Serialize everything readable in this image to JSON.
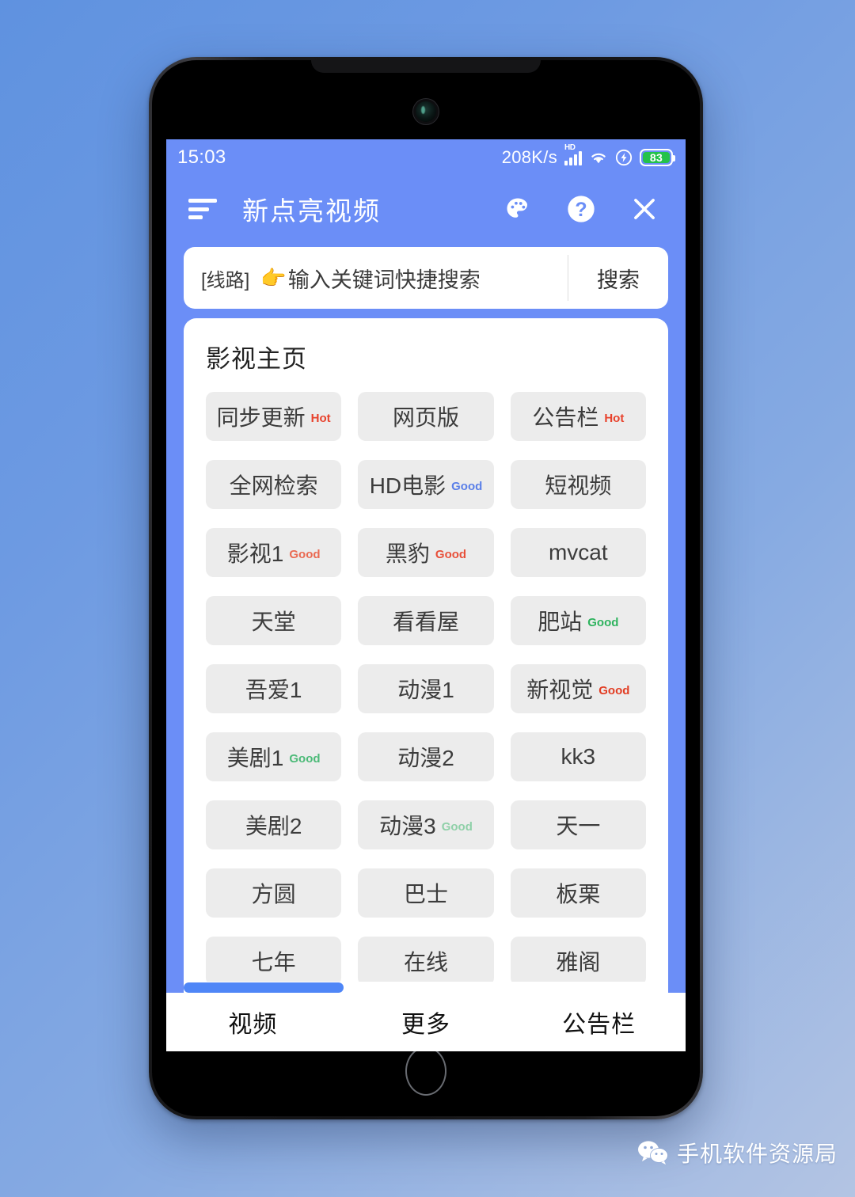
{
  "status_bar": {
    "time": "15:03",
    "net_speed": "208K/s",
    "hd_label": "HD",
    "battery_level": "83",
    "icons": [
      "signal-icon",
      "wifi-icon",
      "charging-bolt-icon",
      "battery-icon"
    ]
  },
  "header": {
    "title": "新点亮视频",
    "menu_icon": "hamburger-menu-icon",
    "palette_icon": "palette-icon",
    "help_icon": "help-question-icon",
    "close_icon": "close-x-icon"
  },
  "search": {
    "route_label": "[线路]",
    "hand_emoji": "👉",
    "placeholder": "输入关键词快捷搜索",
    "value": "",
    "button_label": "搜索"
  },
  "card": {
    "title": "影视主页",
    "tiles": [
      {
        "label": "同步更新",
        "badge": "Hot",
        "badge_color": "#e8422c"
      },
      {
        "label": "网页版",
        "badge": "",
        "badge_color": ""
      },
      {
        "label": "公告栏",
        "badge": "Hot",
        "badge_color": "#e8422c"
      },
      {
        "label": "全网检索",
        "badge": "",
        "badge_color": ""
      },
      {
        "label": "HD电影",
        "badge": "Good",
        "badge_color": "#5a7fe8"
      },
      {
        "label": "短视频",
        "badge": "",
        "badge_color": ""
      },
      {
        "label": "影视1",
        "badge": "Good",
        "badge_color": "#ea6a52"
      },
      {
        "label": "黑豹",
        "badge": "Good",
        "badge_color": "#e8503a"
      },
      {
        "label": "mvcat",
        "badge": "",
        "badge_color": ""
      },
      {
        "label": "天堂",
        "badge": "",
        "badge_color": ""
      },
      {
        "label": "看看屋",
        "badge": "",
        "badge_color": ""
      },
      {
        "label": "肥站",
        "badge": "Good",
        "badge_color": "#2eb35e"
      },
      {
        "label": "吾爱1",
        "badge": "",
        "badge_color": ""
      },
      {
        "label": "动漫1",
        "badge": "",
        "badge_color": ""
      },
      {
        "label": "新视觉",
        "badge": "Good",
        "badge_color": "#e23c22"
      },
      {
        "label": "美剧1",
        "badge": "Good",
        "badge_color": "#4cba78"
      },
      {
        "label": "动漫2",
        "badge": "",
        "badge_color": ""
      },
      {
        "label": "kk3",
        "badge": "",
        "badge_color": ""
      },
      {
        "label": "美剧2",
        "badge": "",
        "badge_color": ""
      },
      {
        "label": "动漫3",
        "badge": "Good",
        "badge_color": "#8fd0a8"
      },
      {
        "label": "天一",
        "badge": "",
        "badge_color": ""
      },
      {
        "label": "方圆",
        "badge": "",
        "badge_color": ""
      },
      {
        "label": "巴士",
        "badge": "",
        "badge_color": ""
      },
      {
        "label": "板栗",
        "badge": "",
        "badge_color": ""
      },
      {
        "label": "七年",
        "badge": "",
        "badge_color": ""
      },
      {
        "label": "在线",
        "badge": "",
        "badge_color": ""
      },
      {
        "label": "雅阁",
        "badge": "",
        "badge_color": ""
      }
    ]
  },
  "bottom_nav": {
    "items": [
      {
        "label": "视频"
      },
      {
        "label": "更多"
      },
      {
        "label": "公告栏"
      }
    ]
  },
  "watermark": {
    "text": "手机软件资源局",
    "icon": "wechat-icon"
  },
  "theme": {
    "accent": "#6b8ef7",
    "screen_bg": "#6b8ef7",
    "card_bg": "#ffffff",
    "tile_bg": "#ececec",
    "scrollbar": "#4f86f7"
  }
}
